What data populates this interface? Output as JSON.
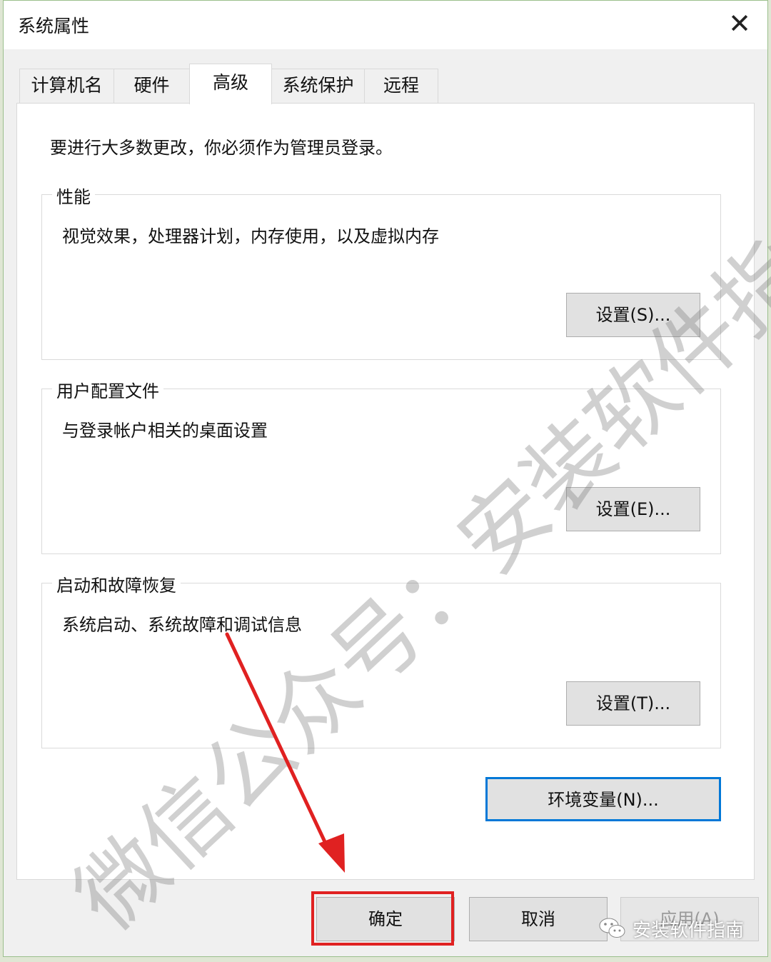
{
  "window": {
    "title": "系统属性",
    "close_glyph": "✕"
  },
  "tabs": [
    {
      "label": "计算机名"
    },
    {
      "label": "硬件"
    },
    {
      "label": "高级",
      "active": true
    },
    {
      "label": "系统保护"
    },
    {
      "label": "远程"
    }
  ],
  "panel": {
    "admin_notice": "要进行大多数更改，你必须作为管理员登录。",
    "groups": [
      {
        "title": "性能",
        "description": "视觉效果，处理器计划，内存使用，以及虚拟内存",
        "button": "设置(S)..."
      },
      {
        "title": "用户配置文件",
        "description": "与登录帐户相关的桌面设置",
        "button": "设置(E)..."
      },
      {
        "title": "启动和故障恢复",
        "description": "系统启动、系统故障和调试信息",
        "button": "设置(T)..."
      }
    ],
    "env_button": "环境变量(N)..."
  },
  "footer": {
    "ok": "确定",
    "cancel": "取消",
    "apply": "应用(A)"
  },
  "watermark": {
    "diagonal_text": "微信公众号：安装软件指南",
    "badge_text": "安装软件指南"
  },
  "annotation": {
    "highlight_color": "#e02121",
    "arrow_color": "#e02121"
  },
  "colors": {
    "focus_border": "#0078d7",
    "button_face": "#e1e1e1"
  }
}
